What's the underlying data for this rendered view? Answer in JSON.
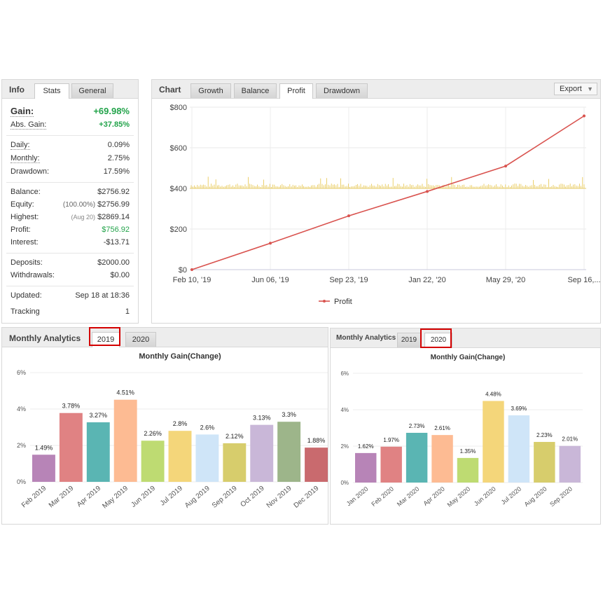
{
  "info": {
    "title": "Info",
    "tabs": [
      "Stats",
      "General"
    ],
    "gain": {
      "label": "Gain:",
      "value": "+69.98%"
    },
    "abs_gain": {
      "label": "Abs. Gain:",
      "value": "+37.85%"
    },
    "daily": {
      "label": "Daily:",
      "value": "0.09%"
    },
    "monthly": {
      "label": "Monthly:",
      "value": "2.75%"
    },
    "drawdown": {
      "label": "Drawdown:",
      "value": "17.59%"
    },
    "balance": {
      "label": "Balance:",
      "value": "$2756.92"
    },
    "equity": {
      "label": "Equity:",
      "note": "(100.00%)",
      "value": "$2756.99"
    },
    "highest": {
      "label": "Highest:",
      "note": "(Aug 20)",
      "value": "$2869.14"
    },
    "profit": {
      "label": "Profit:",
      "value": "$756.92"
    },
    "interest": {
      "label": "Interest:",
      "value": "-$13.71"
    },
    "deposits": {
      "label": "Deposits:",
      "value": "$2000.00"
    },
    "withdrawals": {
      "label": "Withdrawals:",
      "value": "$0.00"
    },
    "updated": {
      "label": "Updated:",
      "value": "Sep 18 at 18:36"
    },
    "tracking": {
      "label": "Tracking",
      "value": "1"
    }
  },
  "chart_panel": {
    "title": "Chart",
    "tabs": [
      "Growth",
      "Balance",
      "Profit",
      "Drawdown"
    ],
    "active_tab": "Profit",
    "export_label": "Export",
    "legend": "Profit"
  },
  "monthly_2019": {
    "title": "Monthly Analytics",
    "tabs": [
      "2019",
      "2020"
    ]
  },
  "monthly_2020": {
    "title": "Monthly Analytics",
    "tabs": [
      "2019",
      "2020"
    ]
  },
  "colors": {
    "green": "#22a34a",
    "profit_line": "#d9534f",
    "volume": "#e6c44a",
    "highlight": "#d40000"
  },
  "chart_data": [
    {
      "type": "line",
      "series": [
        {
          "name": "Profit",
          "color": "#d9534f"
        }
      ],
      "x": [
        "Feb 10, '19",
        "Jun 06, '19",
        "Sep 23, '19",
        "Jan 22, '20",
        "May 29, '20",
        "Sep 16, '20"
      ],
      "y": [
        0,
        130,
        265,
        385,
        510,
        757
      ],
      "x_tick_labels": [
        "Feb 10, '19",
        "Jun 06, '19",
        "Sep 23, '19",
        "Jan 22, '20",
        "May 29, '20",
        "Sep 16,..."
      ],
      "y_tick_labels": [
        "$0",
        "$200",
        "$400",
        "$600",
        "$800"
      ],
      "ylim": [
        0,
        800
      ],
      "grid": true,
      "legend": "bottom"
    },
    {
      "type": "bar",
      "title": "Monthly Gain(Change)",
      "categories": [
        "Feb 2019",
        "Mar 2019",
        "Apr 2019",
        "May 2019",
        "Jun 2019",
        "Jul 2019",
        "Aug 2019",
        "Sep 2019",
        "Oct 2019",
        "Nov 2019",
        "Dec 2019"
      ],
      "values": [
        1.49,
        3.78,
        3.27,
        4.51,
        2.26,
        2.8,
        2.6,
        2.12,
        3.13,
        3.3,
        1.88
      ],
      "labels": [
        "1.49%",
        "3.78%",
        "3.27%",
        "4.51%",
        "2.26%",
        "2.8%",
        "2.6%",
        "2.12%",
        "3.13%",
        "3.3%",
        "1.88%"
      ],
      "colors": [
        "#b784b7",
        "#e08283",
        "#5ab5b3",
        "#fdbb93",
        "#bedb72",
        "#f4d67a",
        "#cfe5f8",
        "#d7cd6c",
        "#c9b7d8",
        "#9db58a",
        "#c96a6e"
      ],
      "y_tick_labels": [
        "0%",
        "2%",
        "4%",
        "6%"
      ],
      "ylim": [
        0,
        6
      ]
    },
    {
      "type": "bar",
      "title": "Monthly Gain(Change)",
      "categories": [
        "Jan 2020",
        "Feb 2020",
        "Mar 2020",
        "Apr 2020",
        "May 2020",
        "Jun 2020",
        "Jul 2020",
        "Aug 2020",
        "Sep 2020"
      ],
      "values": [
        1.62,
        1.97,
        2.73,
        2.61,
        1.35,
        4.48,
        3.69,
        2.23,
        2.01
      ],
      "labels": [
        "1.62%",
        "1.97%",
        "2.73%",
        "2.61%",
        "1.35%",
        "4.48%",
        "3.69%",
        "2.23%",
        "2.01%"
      ],
      "colors": [
        "#b784b7",
        "#e08283",
        "#5ab5b3",
        "#fdbb93",
        "#bedb72",
        "#f4d67a",
        "#cfe5f8",
        "#d7cd6c",
        "#c9b7d8"
      ],
      "y_tick_labels": [
        "0%",
        "2%",
        "4%",
        "6%"
      ],
      "ylim": [
        0,
        6
      ]
    }
  ]
}
